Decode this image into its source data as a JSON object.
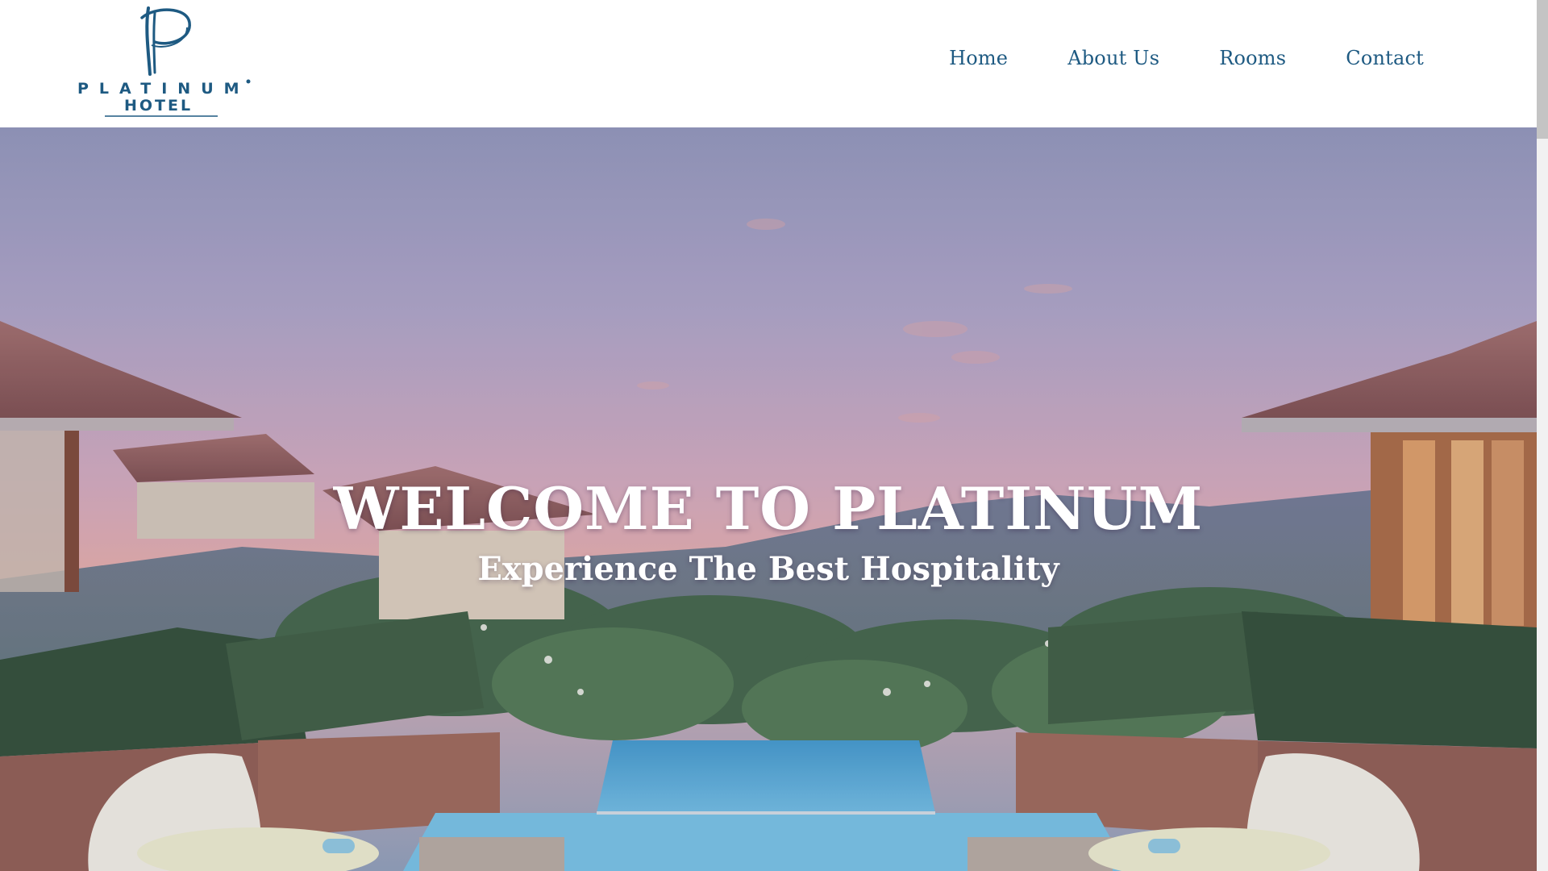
{
  "brand": {
    "logo_word": "PLATINUM",
    "logo_sub": "HOTEL",
    "color": "#1e5a82"
  },
  "nav": {
    "items": [
      {
        "label": "Home"
      },
      {
        "label": "About Us"
      },
      {
        "label": "Rooms"
      },
      {
        "label": "Contact"
      }
    ]
  },
  "hero": {
    "title": "WELCOME TO PLATINUM",
    "subtitle": "Experience The Best Hospitality",
    "image": "resort-infinity-pool-sunset"
  },
  "colors": {
    "sky_top": "#8f93b8",
    "sky_mid": "#c0a4be",
    "sky_horizon": "#e3a9a2",
    "pool": "#57a9d6"
  }
}
